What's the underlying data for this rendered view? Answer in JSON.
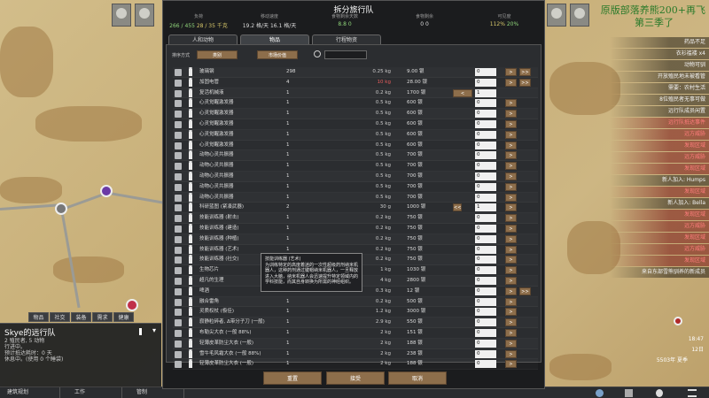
{
  "dialog": {
    "title": "拆分旅行队",
    "stats": [
      {
        "label": "负荷",
        "value_main": "266 / 455",
        "value_alt": "28 / 35 千克"
      },
      {
        "label": "移动速度",
        "value_main": "19.2 格/天",
        "value_alt": "16.1 格/天"
      },
      {
        "label": "食物剩余天数",
        "value_main": "8.8",
        "value_alt": "0"
      },
      {
        "label": "食物剩余",
        "value_main": "0",
        "value_alt": "0"
      },
      {
        "label": "可见度",
        "value_main": "112%",
        "value_alt": "20%"
      }
    ],
    "tabs": [
      "人和动物",
      "物品",
      "行程物资"
    ],
    "sort_label": "排序方式",
    "sort_buttons": [
      "类别",
      "市场价值"
    ],
    "search_placeholder": "",
    "rows": [
      {
        "icon": "sword-icon",
        "name": "玻璃钢",
        "count": "298",
        "mass": "0.25 kg",
        "mass_red": false,
        "value": "9.00 银",
        "left_btn": "",
        "qty": "0",
        "right1": ">",
        "right2": ">>"
      },
      {
        "icon": "gun-icon",
        "name": "加固电管",
        "count": "4",
        "mass": "10 kg",
        "mass_red": true,
        "value": "28.00 银",
        "left_btn": "",
        "qty": "0",
        "right1": ">",
        "right2": ">>"
      },
      {
        "icon": "syringe-icon",
        "name": "复活机械液",
        "count": "1",
        "mass": "0.2 kg",
        "mass_red": false,
        "value": "1700 银",
        "left_btn": "<",
        "qty": "1",
        "right1": "",
        "right2": ""
      },
      {
        "icon": "bionic-icon",
        "name": "心灵觉醒激发器",
        "count": "1",
        "mass": "0.5 kg",
        "mass_red": false,
        "value": "600 银",
        "left_btn": "",
        "qty": "0",
        "right1": ">",
        "right2": ""
      },
      {
        "icon": "bionic-icon",
        "name": "心灵觉醒激发器",
        "count": "1",
        "mass": "0.5 kg",
        "mass_red": false,
        "value": "600 银",
        "left_btn": "",
        "qty": "0",
        "right1": ">",
        "right2": ""
      },
      {
        "icon": "bionic-icon",
        "name": "心灵觉醒激发器",
        "count": "1",
        "mass": "0.5 kg",
        "mass_red": false,
        "value": "600 银",
        "left_btn": "",
        "qty": "0",
        "right1": ">",
        "right2": ""
      },
      {
        "icon": "bionic-icon",
        "name": "心灵觉醒激发器",
        "count": "1",
        "mass": "0.5 kg",
        "mass_red": false,
        "value": "600 银",
        "left_btn": "",
        "qty": "0",
        "right1": ">",
        "right2": ""
      },
      {
        "icon": "bionic-icon",
        "name": "心灵觉醒激发器",
        "count": "1",
        "mass": "0.5 kg",
        "mass_red": false,
        "value": "600 银",
        "left_btn": "",
        "qty": "0",
        "right1": ">",
        "right2": ""
      },
      {
        "icon": "bionic-icon",
        "name": "动物心灵共振器",
        "count": "1",
        "mass": "0.5 kg",
        "mass_red": false,
        "value": "700 银",
        "left_btn": "",
        "qty": "0",
        "right1": ">",
        "right2": ""
      },
      {
        "icon": "bionic-icon",
        "name": "动物心灵共振器",
        "count": "1",
        "mass": "0.5 kg",
        "mass_red": false,
        "value": "700 银",
        "left_btn": "",
        "qty": "0",
        "right1": ">",
        "right2": ""
      },
      {
        "icon": "bionic-icon",
        "name": "动物心灵共振器",
        "count": "1",
        "mass": "0.5 kg",
        "mass_red": false,
        "value": "700 银",
        "left_btn": "",
        "qty": "0",
        "right1": ">",
        "right2": ""
      },
      {
        "icon": "bionic-icon",
        "name": "动物心灵共振器",
        "count": "1",
        "mass": "0.5 kg",
        "mass_red": false,
        "value": "700 银",
        "left_btn": "",
        "qty": "0",
        "right1": ">",
        "right2": ""
      },
      {
        "icon": "bionic-icon",
        "name": "动物心灵共振器",
        "count": "1",
        "mass": "0.5 kg",
        "mass_red": false,
        "value": "700 银",
        "left_btn": "",
        "qty": "0",
        "right1": ">",
        "right2": ""
      },
      {
        "icon": "medkit-icon",
        "name": "科研蓝图 (紧凑武器)",
        "count": "2",
        "mass": "30 g",
        "mass_red": false,
        "value": "1000 银",
        "left_btn": "<<",
        "qty": "1",
        "right1": ">",
        "right2": ""
      },
      {
        "icon": "bionic-icon",
        "name": "技能训练器 (射击)",
        "count": "1",
        "mass": "0.2 kg",
        "mass_red": false,
        "value": "750 银",
        "left_btn": "",
        "qty": "0",
        "right1": ">",
        "right2": ""
      },
      {
        "icon": "bionic-icon",
        "name": "技能训练器 (建造)",
        "count": "1",
        "mass": "0.2 kg",
        "mass_red": false,
        "value": "750 银",
        "left_btn": "",
        "qty": "0",
        "right1": ">",
        "right2": ""
      },
      {
        "icon": "bionic-icon",
        "name": "技能训练器 (种植)",
        "count": "1",
        "mass": "0.2 kg",
        "mass_red": false,
        "value": "750 银",
        "left_btn": "",
        "qty": "0",
        "right1": ">",
        "right2": ""
      },
      {
        "icon": "bionic-icon",
        "name": "技能训练器 (艺术)",
        "count": "1",
        "mass": "0.2 kg",
        "mass_red": false,
        "value": "750 银",
        "left_btn": "",
        "qty": "0",
        "right1": ">",
        "right2": ""
      },
      {
        "icon": "bionic-icon",
        "name": "技能训练器 (社交)",
        "count": "1",
        "mass": "0.2 kg",
        "mass_red": false,
        "value": "750 银",
        "left_btn": "",
        "qty": "0",
        "right1": ">",
        "right2": ""
      },
      {
        "icon": "chip-icon",
        "name": "生物芯片",
        "count": "1",
        "mass": "1 kg",
        "mass_red": false,
        "value": "1030 银",
        "left_btn": "",
        "qty": "0",
        "right1": ">",
        "right2": ""
      },
      {
        "icon": "chip-icon",
        "name": "超凡的生理",
        "count": "1",
        "mass": "4 kg",
        "mass_red": false,
        "value": "2800 银",
        "left_btn": "",
        "qty": "0",
        "right1": ">",
        "right2": ""
      },
      {
        "icon": "beer-icon",
        "name": "啤酒",
        "count": "",
        "mass": "0.3 kg",
        "mass_red": false,
        "value": "12 银",
        "left_btn": "",
        "qty": "0",
        "right1": ">",
        "right2": ">>"
      },
      {
        "icon": "horn-icon",
        "name": "融合雷角",
        "count": "1",
        "mass": "0.2 kg",
        "mass_red": false,
        "value": "500 银",
        "left_btn": "",
        "qty": "0",
        "right1": ">",
        "right2": ""
      },
      {
        "icon": "staff-icon",
        "name": "灵质权杖 (极佳)",
        "count": "1",
        "mass": "1.2 kg",
        "mass_red": false,
        "value": "3000 银",
        "left_btn": "",
        "qty": "0",
        "right1": ">",
        "right2": ""
      },
      {
        "icon": "gun-icon",
        "name": "寂静粒碎者, Δ带分子刀 (一般)",
        "count": "1",
        "mass": "2.9 kg",
        "mass_red": false,
        "value": "550 银",
        "left_btn": "",
        "qty": "0",
        "right1": ">",
        "right2": ""
      },
      {
        "icon": "armor-icon",
        "name": "布勒尖大衣 (一般 88%)",
        "count": "1",
        "mass": "2 kg",
        "mass_red": false,
        "value": "151 银",
        "left_btn": "",
        "qty": "0",
        "right1": ">",
        "right2": ""
      },
      {
        "icon": "armor-icon",
        "name": "轻薄皮革防尘大衣 (一般)",
        "count": "1",
        "mass": "2 kg",
        "mass_red": false,
        "value": "188 银",
        "left_btn": "",
        "qty": "0",
        "right1": ">",
        "right2": ""
      },
      {
        "icon": "armor-icon",
        "name": "雪牛毛风霜大衣 (一般 88%)",
        "count": "1",
        "mass": "2 kg",
        "mass_red": false,
        "value": "238 银",
        "left_btn": "",
        "qty": "0",
        "right1": ">",
        "right2": ""
      },
      {
        "icon": "armor-icon",
        "name": "轻薄皮革防尘大衣 (一般)",
        "count": "1",
        "mass": "2 kg",
        "mass_red": false,
        "value": "188 银",
        "left_btn": "",
        "qty": "0",
        "right1": ">",
        "right2": ""
      }
    ],
    "tooltip": "技能训练器 (艺术)\n为训练特定的高度着迷的一次性超级药剂纳米机器人，这种药剂通过键帽纳米机器人，一旦释放进入大脑，纳米机器人会迅速提升特定领域内的学科技能，而其自身转换为所需的神经组织。",
    "footer_buttons": [
      "重置",
      "接受",
      "取消"
    ]
  },
  "inspect": {
    "name": "Skye的远行队",
    "lines": [
      "2 殖民者, 5 动物",
      "行进中。",
      "预计抵达耗时：0 天",
      "休息中。(使用 0 个睡袋)"
    ],
    "tabs": [
      "物品",
      "社交",
      "装备",
      "需求",
      "健康"
    ]
  },
  "bottom_bar": [
    "建筑规划",
    "工作",
    "管制"
  ],
  "overlay": {
    "title_line1": "原版部落养熊200+再飞",
    "title_line2": "第三季了",
    "alerts": [
      {
        "text": "药品不足",
        "red": false
      },
      {
        "text": "衣衫褴褛 x4",
        "red": false
      },
      {
        "text": "动物可驯",
        "red": false
      },
      {
        "text": "开放殖民地未被看管",
        "red": false
      },
      {
        "text": "需要：农村生活",
        "red": false
      },
      {
        "text": "8位殖民者无事可做",
        "red": false
      },
      {
        "text": "远行队成员闲置",
        "red": false
      },
      {
        "text": "远行队抵达事件",
        "red": true
      },
      {
        "text": "远方威胁",
        "red": true
      },
      {
        "text": "发现区域",
        "red": true
      },
      {
        "text": "远方威胁",
        "red": true
      },
      {
        "text": "发现区域",
        "red": true
      },
      {
        "text": "新人加入: Humps",
        "red": false
      },
      {
        "text": "发现区域",
        "red": true
      },
      {
        "text": "新人加入: Bella",
        "red": false
      },
      {
        "text": "发现区域",
        "red": true
      },
      {
        "text": "远方威胁",
        "red": true
      },
      {
        "text": "发现区域",
        "red": true
      },
      {
        "text": "远方威胁",
        "red": true
      },
      {
        "text": "发现区域",
        "red": true
      },
      {
        "text": "来自东部雪熊驯养的新成员",
        "red": false
      }
    ],
    "clock": "18:47",
    "date": "12日",
    "year": "5503年 夏季"
  },
  "colors": {
    "brand_button": "#8d6e4b",
    "dialog_bg": "#1b1c1e",
    "panel_bg": "#2b2d30",
    "positive": "#8fd47a",
    "negative": "#e65c5c"
  }
}
